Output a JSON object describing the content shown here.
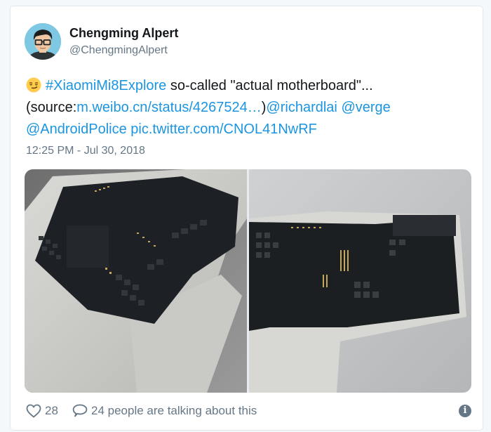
{
  "author": {
    "name": "Chengming Alpert",
    "handle": "@ChengmingAlpert",
    "avatar_icon": "avatar-glasses-icon"
  },
  "tweet": {
    "emoji": "smirking-face-emoji",
    "hashtag": "#XiaomiMi8Explore",
    "text1": " so-called \"actual motherboard\"...",
    "text2": "(source:",
    "link_source": "m.weibo.cn/status/4267524…",
    "text3": ")",
    "mention1": "@richardlai",
    "mention2": "@verge",
    "mention3": "@AndroidPolice",
    "pic_link": "pic.twitter.com/CNOL41NwRF",
    "timestamp": "12:25 PM - Jul 30, 2018"
  },
  "media": {
    "photos": [
      "motherboard-photo-angled",
      "motherboard-photo-flat"
    ]
  },
  "actions": {
    "like_count": "28",
    "reply_text": "24 people are talking about this",
    "like_icon": "heart-icon",
    "reply_icon": "speech-bubble-icon",
    "info_icon": "info-icon"
  },
  "colors": {
    "link": "#1b95e0",
    "secondary_text": "#657786",
    "border": "#e1e8ed"
  }
}
